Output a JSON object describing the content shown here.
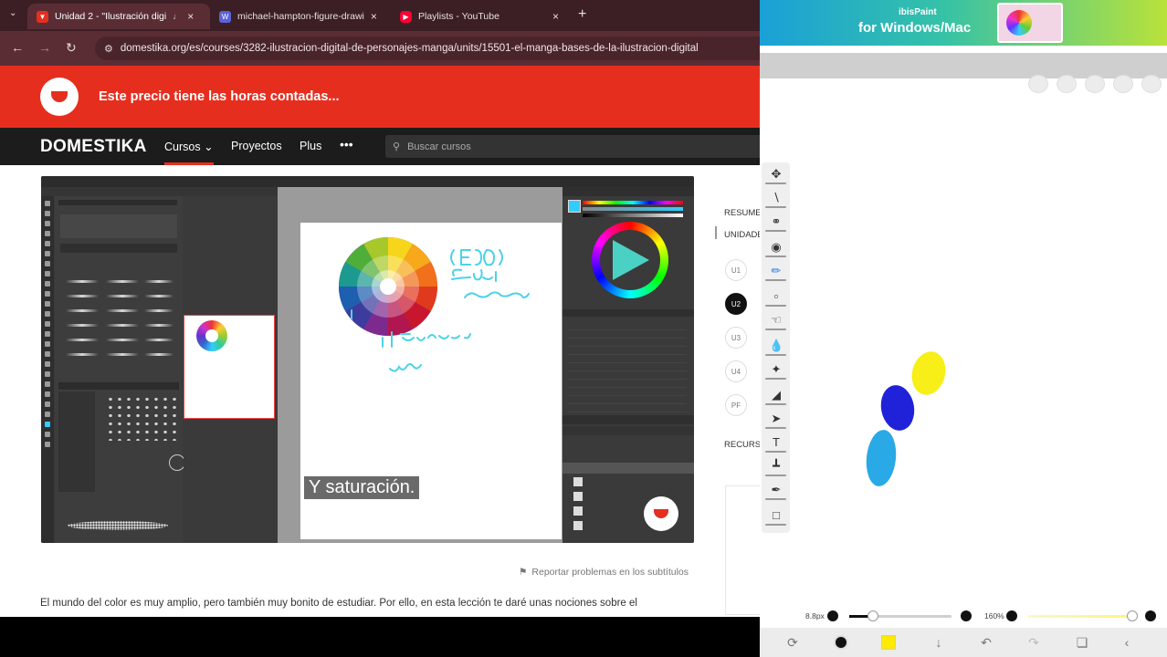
{
  "browser": {
    "tabs": [
      {
        "title": "Unidad 2 - \"Ilustración digi",
        "favicon": "domestika-icon",
        "color": "#e62e1f",
        "active": true
      },
      {
        "title": "michael-hampton-figure-drawi",
        "favicon": "globe-icon",
        "color": "#5b62d8",
        "active": false
      },
      {
        "title": "Playlists - YouTube",
        "favicon": "youtube-icon",
        "color": "#ff0033",
        "active": false
      }
    ],
    "url": "domestika.org/es/courses/3282-ilustracion-digital-de-personajes-manga/units/15501-el-manga-bases-de-la-ilustracion-digital"
  },
  "promo": {
    "message": "Este precio tiene las horas contadas..."
  },
  "nav": {
    "brand": "DOMESTIKA",
    "courses": "Cursos",
    "projects": "Proyectos",
    "plus": "Plus",
    "more": "•••",
    "search_placeholder": "Buscar cursos"
  },
  "video": {
    "subtitle": "Y saturación."
  },
  "sidebar": {
    "summary": "RESUMEN",
    "units": "UNIDADES",
    "unit_items": [
      "U1",
      "U2",
      "U3",
      "U4",
      "PF"
    ],
    "active_unit": "U2",
    "resources": "RECURSOS"
  },
  "report_label": "Reportar problemas en los subtítulos",
  "lesson_text": "El mundo del color es muy amplio, pero también muy bonito de estudiar. Por ello, en esta lección te daré unas nociones sobre el",
  "ibispaint": {
    "ad_line1": "ibisPaint",
    "ad_line2": "for Windows/Mac",
    "brush_size": "8.8px",
    "zoom": "160%",
    "current_color": "#ffea00",
    "blobs": [
      {
        "color": "#f7ef17"
      },
      {
        "color": "#1f22d9"
      },
      {
        "color": "#29a9e6"
      }
    ]
  }
}
